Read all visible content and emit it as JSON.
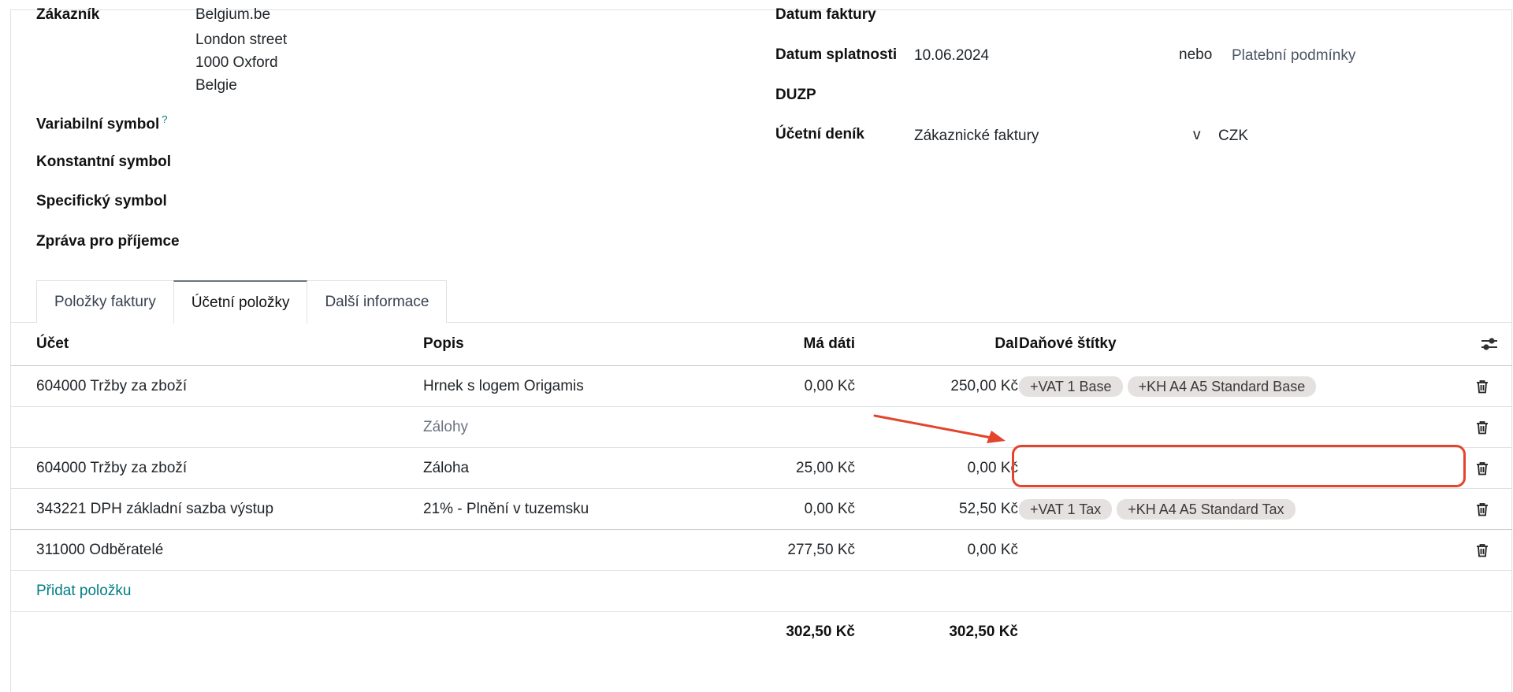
{
  "form": {
    "customer_label": "Zákazník",
    "customer_address": [
      "Belgium.be",
      "London street",
      "1000 Oxford",
      "Belgie"
    ],
    "variable_symbol_label": "Variabilní symbol",
    "variable_symbol_help": "?",
    "constant_symbol_label": "Konstantní symbol",
    "specific_symbol_label": "Specifický symbol",
    "message_label": "Zpráva pro příjemce",
    "invoice_date_label": "Datum faktury",
    "due_date_label": "Datum splatnosti",
    "due_date_value": "10.06.2024",
    "or_label": "nebo",
    "payment_terms_placeholder": "Platební podmínky",
    "duzp_label": "DUZP",
    "journal_label": "Účetní deník",
    "journal_value": "Zákaznické faktury",
    "in_label": "v",
    "currency_value": "CZK"
  },
  "tabs": [
    {
      "label": "Položky faktury",
      "active": false
    },
    {
      "label": "Účetní položky",
      "active": true
    },
    {
      "label": "Další informace",
      "active": false
    }
  ],
  "table": {
    "columns": {
      "account": "Účet",
      "description": "Popis",
      "debit": "Má dáti",
      "credit": "Dal",
      "tax_tags": "Daňové štítky"
    },
    "rows": [
      {
        "account": "604000 Tržby za zboží",
        "description": "Hrnek s logem Origamis",
        "debit": "0,00 Kč",
        "credit": "250,00 Kč",
        "tags": [
          "+VAT 1 Base",
          "+KH A4 A5 Standard Base"
        ]
      },
      {
        "section": "Zálohy"
      },
      {
        "account": "604000 Tržby za zboží",
        "description": "Záloha",
        "debit": "25,00 Kč",
        "credit": "0,00 Kč",
        "tags": []
      },
      {
        "account": "343221 DPH základní sazba výstup",
        "description": "21% - Plnění v tuzemsku",
        "debit": "0,00 Kč",
        "credit": "52,50 Kč",
        "tags": [
          "+VAT 1 Tax",
          "+KH A4 A5 Standard Tax"
        ]
      },
      {
        "account": "311000 Odběratelé",
        "description": "",
        "debit": "277,50 Kč",
        "credit": "0,00 Kč",
        "tags": []
      }
    ],
    "add_line": "Přidat položku",
    "total_debit": "302,50 Kč",
    "total_credit": "302,50 Kč"
  },
  "annotation_color": "#e3452c"
}
